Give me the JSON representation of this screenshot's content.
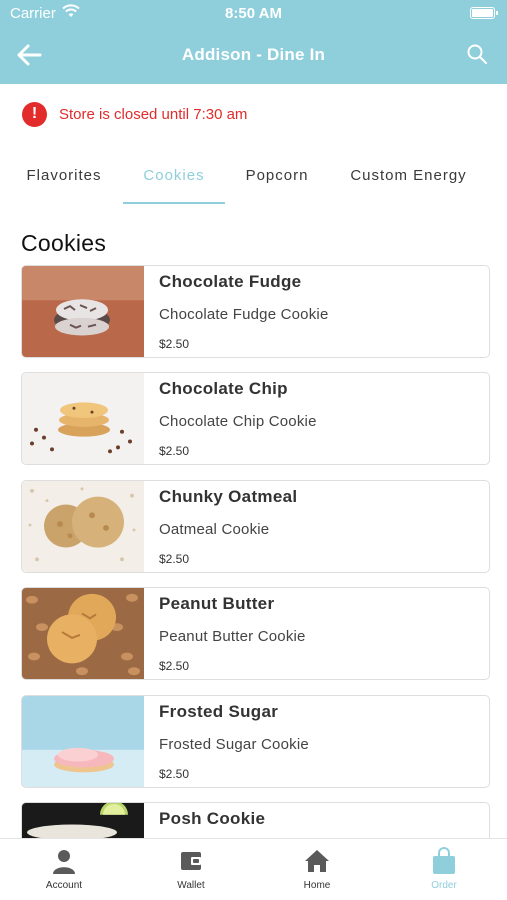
{
  "status_bar": {
    "carrier": "Carrier",
    "time": "8:50 AM"
  },
  "header": {
    "title": "Addison - Dine In"
  },
  "alert": {
    "icon": "!",
    "text": "Store is closed until 7:30 am"
  },
  "tabs": [
    {
      "label": "Flavorites",
      "active": false
    },
    {
      "label": "Cookies",
      "active": true
    },
    {
      "label": "Popcorn",
      "active": false
    },
    {
      "label": "Custom Energy",
      "active": false
    }
  ],
  "section_title": "Cookies",
  "products": [
    {
      "name": "Chocolate Fudge",
      "description": "Chocolate Fudge Cookie",
      "price": "$2.50"
    },
    {
      "name": "Chocolate Chip",
      "description": "Chocolate Chip Cookie",
      "price": "$2.50"
    },
    {
      "name": "Chunky Oatmeal",
      "description": "Oatmeal Cookie",
      "price": "$2.50"
    },
    {
      "name": "Peanut Butter",
      "description": "Peanut Butter Cookie",
      "price": "$2.50"
    },
    {
      "name": "Frosted Sugar",
      "description": "Frosted Sugar Cookie",
      "price": "$2.50"
    },
    {
      "name": "Posh Cookie",
      "description": "",
      "price": ""
    }
  ],
  "tab_bar": [
    {
      "label": "Account",
      "icon": "person-icon",
      "active": false
    },
    {
      "label": "Wallet",
      "icon": "wallet-icon",
      "active": false
    },
    {
      "label": "Home",
      "icon": "home-icon",
      "active": false
    },
    {
      "label": "Order",
      "icon": "shopping-bag-icon",
      "active": true
    }
  ],
  "colors": {
    "accent": "#8fcfdc",
    "alert": "#e22b2b",
    "text": "#333333",
    "card_border": "#dedede"
  }
}
